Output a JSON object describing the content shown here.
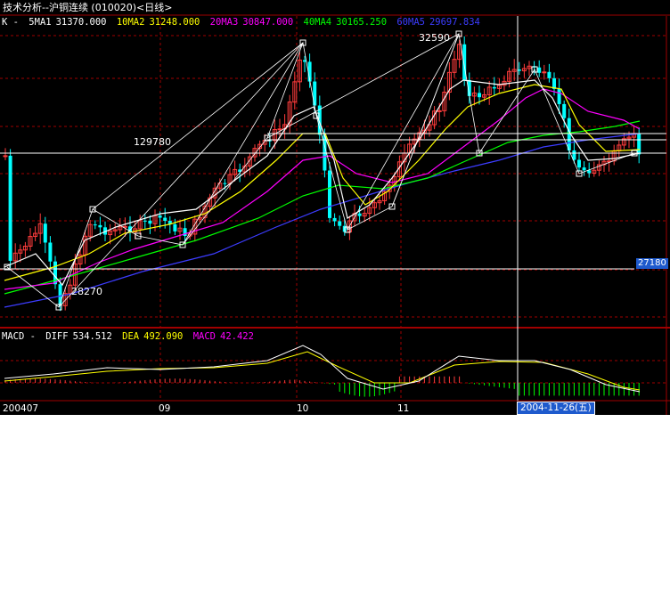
{
  "window": {
    "title": "技术分析--沪铜连续 (010020)<日线>"
  },
  "k_panel": {
    "legend_prefix": "K  -",
    "indicators": [
      {
        "label": "5MA1",
        "value": "31370.000",
        "color": "#ffffff"
      },
      {
        "label": "10MA2",
        "value": "31248.000",
        "color": "#ffff00"
      },
      {
        "label": "20MA3",
        "value": "30847.000",
        "color": "#ff00ff"
      },
      {
        "label": "40MA4",
        "value": "30165.250",
        "color": "#00ff00"
      },
      {
        "label": "60MA5",
        "value": "29697.834",
        "color": "#3c3cff"
      }
    ],
    "annotations": {
      "peak": "32590",
      "trough": "28270",
      "level": "129780"
    },
    "price_tag": "27180"
  },
  "macd_panel": {
    "prefix": "MACD  -",
    "diff_label": "DIFF",
    "diff_value": "534.512",
    "dea_label": "DEA",
    "dea_value": "492.090",
    "macd_label": "MACD",
    "macd_value": "42.422"
  },
  "x_axis": {
    "start": "200407",
    "ticks": [
      "09",
      "10",
      "11"
    ],
    "cursor_date": "2004-11-26",
    "cursor_weekday": "(五)"
  },
  "colors": {
    "background": "#000000",
    "up": "#ff3c3c",
    "down": "#00ffff",
    "grid": "#a00000"
  },
  "chart_data": {
    "type": "candlestick",
    "title": "技术分析--沪铜连续 (010020)<日线>",
    "period": "daily",
    "date_range": [
      "2004-07",
      "2004-12"
    ],
    "notable_high": 32590,
    "notable_low": 28270,
    "latest_moving_averages": {
      "MA5": 31370.0,
      "MA10": 31248.0,
      "MA20": 30847.0,
      "MA40": 30165.25,
      "MA60": 29697.834
    },
    "latest_macd": {
      "DIFF": 534.512,
      "DEA": 492.09,
      "MACD": 42.422
    },
    "cursor_date": "2004-11-26"
  }
}
